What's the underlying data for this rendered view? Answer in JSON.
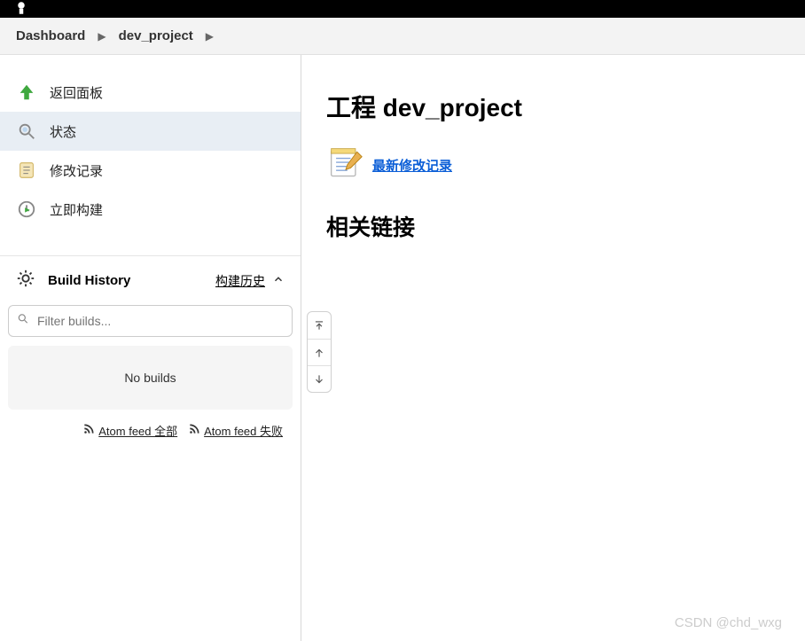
{
  "breadcrumb": {
    "root": "Dashboard",
    "project": "dev_project"
  },
  "sidebar": {
    "items": [
      {
        "label": "返回面板",
        "icon": "arrow-up-green"
      },
      {
        "label": "状态",
        "icon": "magnifier"
      },
      {
        "label": "修改记录",
        "icon": "notepad"
      },
      {
        "label": "立即构建",
        "icon": "clock-play"
      }
    ]
  },
  "build_history": {
    "title": "Build History",
    "toggle_label": "构建历史",
    "filter_placeholder": "Filter builds...",
    "empty_text": "No builds",
    "feeds": {
      "all": "Atom feed 全部",
      "fail": "Atom feed 失败"
    }
  },
  "main": {
    "title_prefix": "工程",
    "title_name": "dev_project",
    "changes_link": "最新修改记录",
    "related_title": "相关链接"
  },
  "watermark": "CSDN @chd_wxg"
}
